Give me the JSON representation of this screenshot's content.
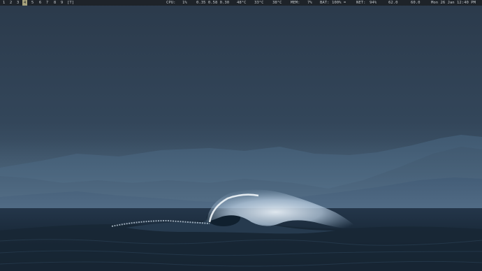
{
  "statusbar": {
    "workspaces": [
      "1",
      "2",
      "3",
      "4",
      "5",
      "6",
      "7",
      "8",
      "9"
    ],
    "active_workspace": "4",
    "layout_tag": "[T]",
    "cpu_label": "CPU:",
    "cpu_value": "1%",
    "load": "0.35 0.58 0.30",
    "temp_1": "48°C",
    "temp_2": "33°C",
    "temp_3": "38°C",
    "mem_label": "MEM:",
    "mem_value": "7%",
    "bat_label": "BAT:",
    "bat_value": "100% =",
    "net_label": "NET:",
    "net_value": "94%",
    "value_a": "62.0",
    "value_b": "60.0",
    "date": "Mon 26 Jan",
    "time": "12:40 PM"
  },
  "colors": {
    "bar_background": "#1e2329",
    "bar_text": "#c2c7cc",
    "active_workspace": "#a6a27c",
    "sky": "#2e3d4e",
    "sea": "#1b2b3b"
  }
}
